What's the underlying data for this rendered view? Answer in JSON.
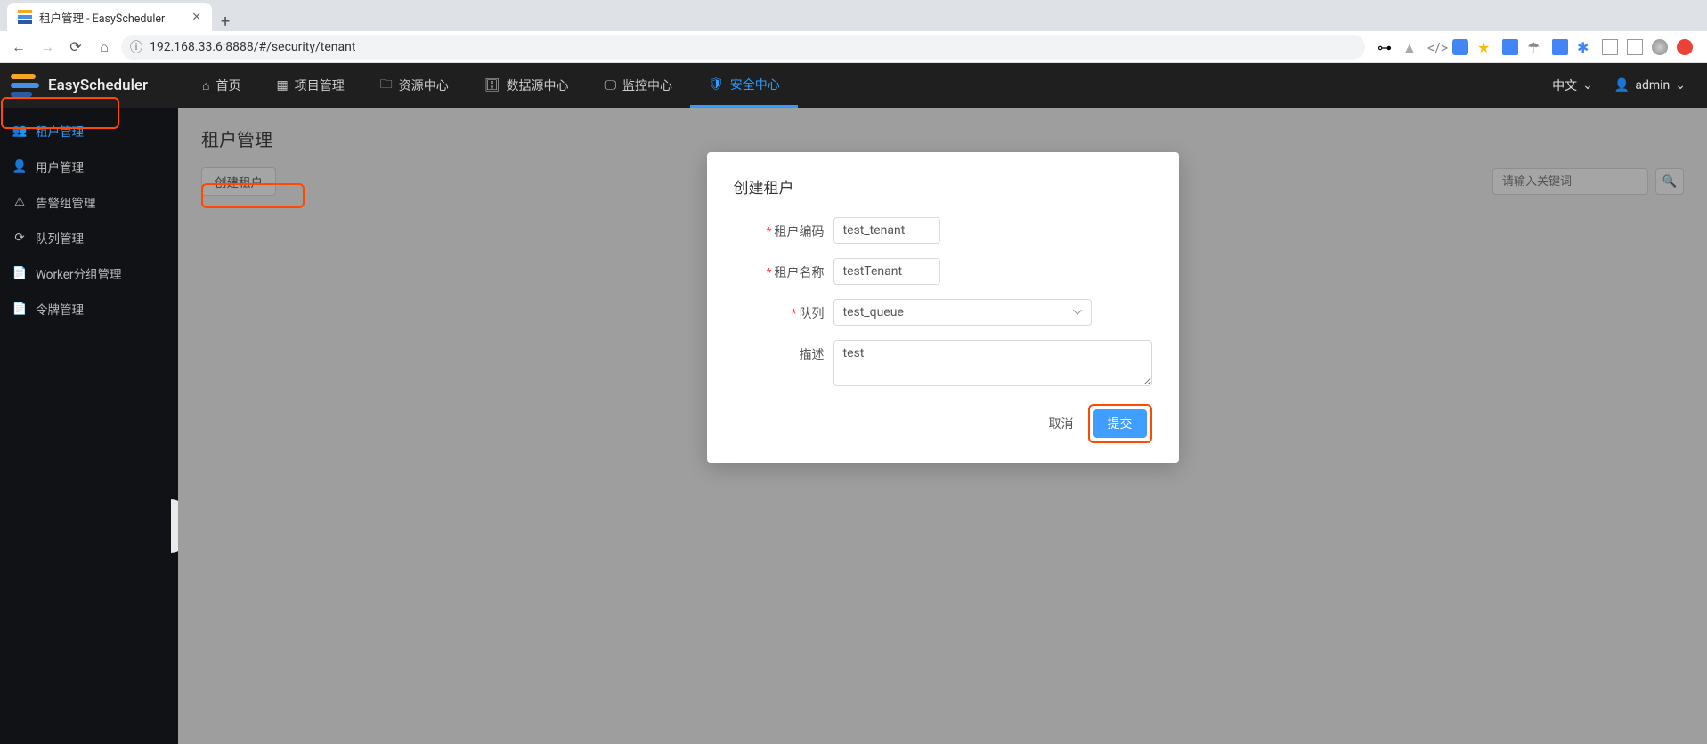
{
  "browser": {
    "tab_title": "租户管理 - EasyScheduler",
    "url": "192.168.33.6:8888/#/security/tenant",
    "url_prefix_highlight": "192.168.33.6"
  },
  "brand": "EasyScheduler",
  "topnav": [
    {
      "label": "首页",
      "icon": "home"
    },
    {
      "label": "项目管理",
      "icon": "dashboard"
    },
    {
      "label": "资源中心",
      "icon": "folder"
    },
    {
      "label": "数据源中心",
      "icon": "database"
    },
    {
      "label": "监控中心",
      "icon": "monitor"
    },
    {
      "label": "安全中心",
      "icon": "shield",
      "active": true
    }
  ],
  "right": {
    "lang": "中文",
    "user": "admin"
  },
  "sidebar": [
    {
      "label": "租户管理",
      "icon": "users",
      "active": true
    },
    {
      "label": "用户管理",
      "icon": "user"
    },
    {
      "label": "告警组管理",
      "icon": "warning"
    },
    {
      "label": "队列管理",
      "icon": "refresh"
    },
    {
      "label": "Worker分组管理",
      "icon": "file-plus"
    },
    {
      "label": "令牌管理",
      "icon": "document"
    }
  ],
  "page": {
    "title": "租户管理",
    "create_button": "创建租户",
    "search_placeholder": "请输入关键词"
  },
  "dialog": {
    "title": "创建租户",
    "fields": {
      "tenant_code": {
        "label": "租户编码",
        "value": "test_tenant",
        "required": true
      },
      "tenant_name": {
        "label": "租户名称",
        "value": "testTenant",
        "required": true
      },
      "queue": {
        "label": "队列",
        "value": "test_queue",
        "required": true
      },
      "description": {
        "label": "描述",
        "value": "test",
        "required": false
      }
    },
    "cancel": "取消",
    "submit": "提交"
  }
}
